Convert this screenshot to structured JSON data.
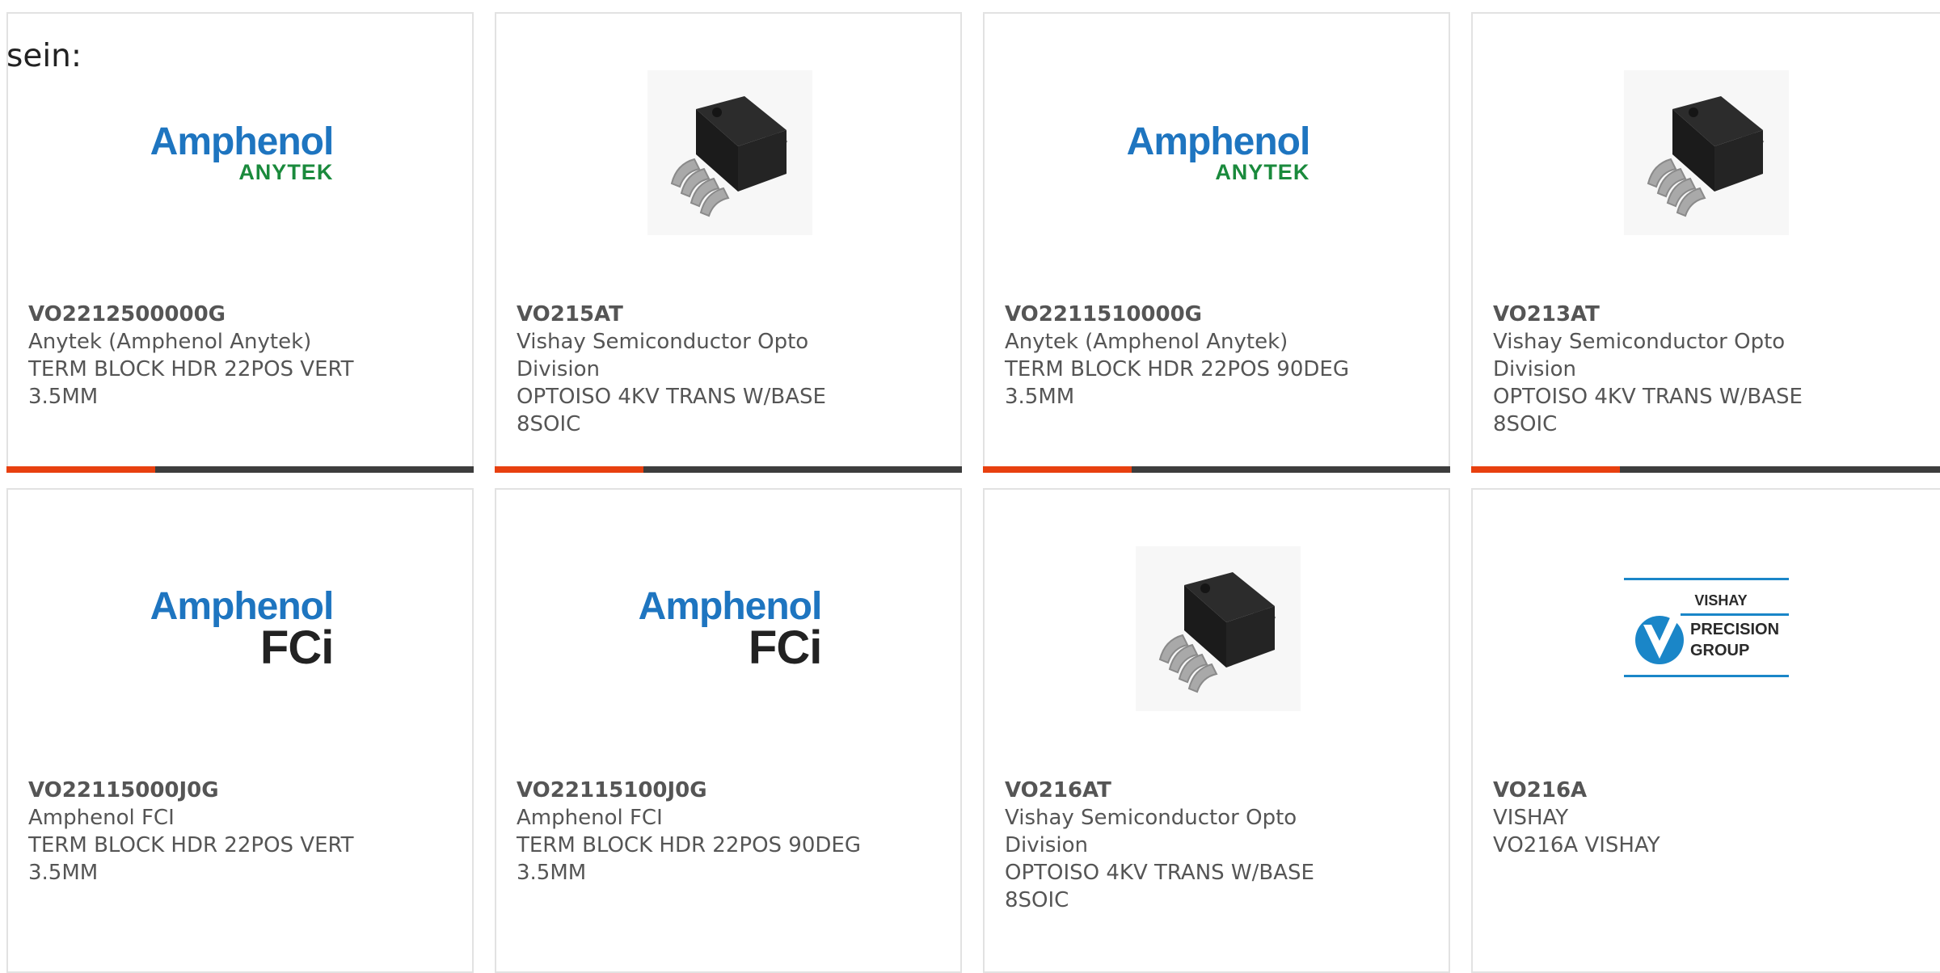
{
  "intro_text": "sein:",
  "colors": {
    "accent": "#e8400f",
    "bar": "#3d3d3d",
    "border": "#e2e2e2",
    "text": "#555555"
  },
  "products": [
    {
      "part": "VO2212500000G",
      "maker": "Anytek (Amphenol Anytek)",
      "desc": [
        "TERM BLOCK HDR 22POS VERT",
        "3.5MM"
      ],
      "image": "amphenol-anytek-logo",
      "logo_top": "Amphenol",
      "logo_bottom": "ANYTEK"
    },
    {
      "part": "VO215AT",
      "maker": "Vishay Semiconductor Opto",
      "maker2": "Division",
      "desc": [
        "OPTOISO 4KV TRANS W/BASE",
        "8SOIC"
      ],
      "image": "soic-8-chip"
    },
    {
      "part": "VO2211510000G",
      "maker": "Anytek (Amphenol Anytek)",
      "desc": [
        "TERM BLOCK HDR 22POS 90DEG",
        "3.5MM"
      ],
      "image": "amphenol-anytek-logo",
      "logo_top": "Amphenol",
      "logo_bottom": "ANYTEK"
    },
    {
      "part": "VO213AT",
      "maker": "Vishay Semiconductor Opto",
      "maker2": "Division",
      "desc": [
        "OPTOISO 4KV TRANS W/BASE",
        "8SOIC"
      ],
      "image": "soic-8-chip"
    },
    {
      "part": "VO22115000J0G",
      "maker": "Amphenol FCI",
      "desc": [
        "TERM BLOCK HDR 22POS VERT",
        "3.5MM"
      ],
      "image": "amphenol-fci-logo",
      "logo_top": "Amphenol",
      "logo_bottom": "FCi"
    },
    {
      "part": "VO22115100J0G",
      "maker": "Amphenol FCI",
      "desc": [
        "TERM BLOCK HDR 22POS 90DEG",
        "3.5MM"
      ],
      "image": "amphenol-fci-logo",
      "logo_top": "Amphenol",
      "logo_bottom": "FCi"
    },
    {
      "part": "VO216AT",
      "maker": "Vishay Semiconductor Opto",
      "maker2": "Division",
      "desc": [
        "OPTOISO 4KV TRANS W/BASE",
        "8SOIC"
      ],
      "image": "soic-8-chip"
    },
    {
      "part": "VO216A",
      "maker": "VISHAY",
      "desc": [
        "VO216A VISHAY"
      ],
      "image": "vishay-precision-group-logo",
      "logo_lines": [
        "VISHAY",
        "PRECISION",
        "GROUP"
      ]
    }
  ]
}
